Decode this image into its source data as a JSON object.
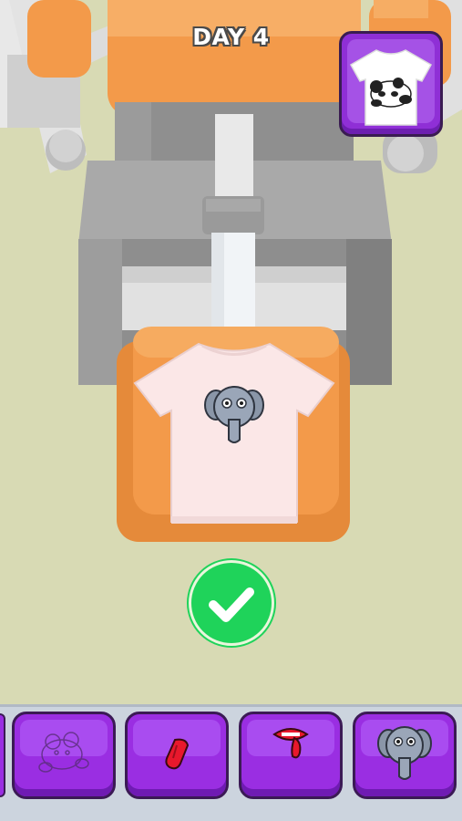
{
  "hud": {
    "day_label": "DAY 4"
  },
  "target": {
    "icon": "panda-tshirt-icon"
  },
  "workspace": {
    "shirt_icon": "tshirt-icon",
    "decal_icon": "elephant-icon"
  },
  "confirm": {
    "icon": "checkmark-icon"
  },
  "decals": [
    {
      "icon": "panda-outline-icon"
    },
    {
      "icon": "tongue-icon"
    },
    {
      "icon": "lips-tongue-icon"
    },
    {
      "icon": "elephant-icon"
    }
  ],
  "colors": {
    "floor": "#d8dab4",
    "press_orange": "#f39a4a",
    "machine_gray": "#c9c9c9",
    "purple_button": "#9a2ee2",
    "confirm_green": "#1fd35a"
  }
}
